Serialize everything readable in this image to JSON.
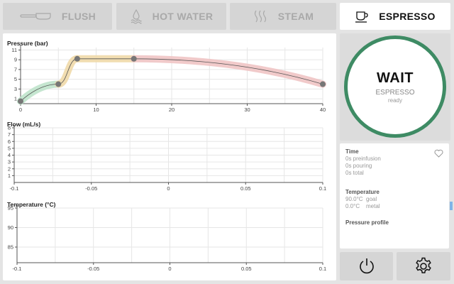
{
  "toolbar": {
    "flush_label": "FLUSH",
    "hotwater_label": "HOT WATER",
    "steam_label": "STEAM",
    "espresso_label": "ESPRESSO"
  },
  "status": {
    "state": "WAIT",
    "mode": "ESPRESSO",
    "substate": "ready"
  },
  "info": {
    "time_heading": "Time",
    "time_lines": [
      "0s preinfusion",
      "0s pouring",
      "0s total"
    ],
    "temperature_heading": "Temperature",
    "temperature_lines": [
      "90.0°C  goal",
      "0.0°C    metal"
    ],
    "profile_heading": "Pressure profile"
  },
  "icons": {
    "flush": "portafilter-icon",
    "hotwater": "water-drop-icon",
    "steam": "steam-icon",
    "espresso": "coffee-cup-icon",
    "favorite": "heart-icon",
    "power": "power-icon",
    "settings": "gear-icon"
  },
  "colors": {
    "accent_green": "#3e8b64",
    "phase_preinfusion": "#bfe3cb",
    "phase_rise": "#f0d9a8",
    "phase_decline": "#f0c4c4"
  },
  "chart_data": [
    {
      "type": "line",
      "title": "Pressure (bar)",
      "x": [
        0,
        5,
        7.5,
        15,
        40
      ],
      "series": [
        {
          "values": [
            0.5,
            4,
            9.2,
            9.2,
            4
          ]
        }
      ],
      "phases": [
        {
          "from": 0,
          "to": 5,
          "color": "#bfe3cb"
        },
        {
          "from": 5,
          "to": 7.5,
          "color": "#f0d9a8"
        },
        {
          "from": 7.5,
          "to": 15,
          "color": "#f0d9a8"
        },
        {
          "from": 15,
          "to": 40,
          "color": "#f0c4c4"
        }
      ],
      "xticks": [
        "0",
        "10",
        "20",
        "30",
        "40"
      ],
      "yticks": [
        "1",
        "3",
        "5",
        "7",
        "9",
        "11"
      ],
      "xlim": [
        0,
        40
      ],
      "ylim": [
        0,
        11.5
      ],
      "grid": true
    },
    {
      "type": "line",
      "title": "Flow (mL/s)",
      "series": [],
      "xticks": [
        "-0.1",
        "-0.05",
        "0",
        "0.05",
        "0.1"
      ],
      "yticks": [
        "1",
        "2",
        "3",
        "4",
        "5",
        "6",
        "7",
        "8"
      ],
      "xlim": [
        -0.1,
        0.1
      ],
      "ylim": [
        0,
        8
      ],
      "grid": true
    },
    {
      "type": "line",
      "title": "Temperature (°C)",
      "series": [],
      "xticks": [
        "-0.1",
        "-0.05",
        "0",
        "0.05",
        "0.1"
      ],
      "yticks": [
        "85",
        "90",
        "95"
      ],
      "xlim": [
        -0.1,
        0.1
      ],
      "ylim": [
        81,
        95
      ],
      "grid": true
    }
  ]
}
